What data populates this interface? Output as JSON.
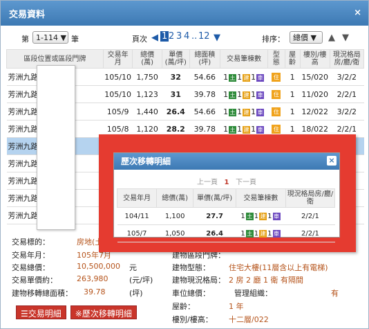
{
  "window": {
    "title": "交易資料",
    "close": "×"
  },
  "pager": {
    "prefix": "第",
    "range": "1-114",
    "suffix": "筆",
    "page_label": "頁次",
    "pages": [
      "1",
      "2",
      "3",
      "4",
      "..",
      " 12"
    ],
    "sort_label": "排序：",
    "sort_value": "總價"
  },
  "columns": [
    "區段位置或區段門牌",
    "交易年月",
    "總價(萬)",
    "單價(萬/坪)",
    "總面積(坪)",
    "交易筆棟數",
    "型態",
    "屋齡",
    "樓別/樓高",
    "現況格局房/廳/衛"
  ],
  "rows": [
    {
      "addr": "芳洲九路",
      "date": "105/10",
      "total": "1,750",
      "unit": "32",
      "area": "54.66",
      "counts": [
        "1",
        "1",
        "1"
      ],
      "type": "住",
      "age": "1",
      "floor": "15/020",
      "layout": "3/2/2"
    },
    {
      "addr": "芳洲九路",
      "date": "105/10",
      "total": "1,123",
      "unit": "31",
      "area": "39.78",
      "counts": [
        "1",
        "1",
        "1"
      ],
      "type": "住",
      "age": "1",
      "floor": "11/020",
      "layout": "2/2/1"
    },
    {
      "addr": "芳洲九路",
      "date": "105/9",
      "total": "1,440",
      "unit": "26.4",
      "area": "54.66",
      "counts": [
        "1",
        "1",
        "1"
      ],
      "type": "住",
      "age": "1",
      "floor": "12/022",
      "layout": "3/2/2"
    },
    {
      "addr": "芳洲九路",
      "date": "105/8",
      "total": "1,120",
      "unit": "28.2",
      "area": "39.78",
      "counts": [
        "1",
        "1",
        "1"
      ],
      "type": "住",
      "age": "1",
      "floor": "18/022",
      "layout": "2/2/1"
    },
    {
      "addr": "芳洲九路",
      "date": "",
      "total": "",
      "unit": "",
      "area": "",
      "counts": [
        "",
        "",
        ""
      ],
      "type": "",
      "age": "",
      "floor": "",
      "layout": ""
    },
    {
      "addr": "芳洲九路",
      "date": "",
      "total": "",
      "unit": "",
      "area": "",
      "counts": [
        "",
        "",
        ""
      ],
      "type": "",
      "age": "",
      "floor": "",
      "layout": ""
    },
    {
      "addr": "芳洲九路",
      "date": "",
      "total": "",
      "unit": "",
      "area": "",
      "counts": [
        "",
        "",
        ""
      ],
      "type": "",
      "age": "",
      "floor": "",
      "layout": ""
    },
    {
      "addr": "芳洲九路",
      "date": "",
      "total": "",
      "unit": "",
      "area": "",
      "counts": [
        "",
        "",
        ""
      ],
      "type": "",
      "age": "",
      "floor": "",
      "layout": ""
    },
    {
      "addr": "芳洲九路",
      "date": "",
      "total": "",
      "unit": "",
      "area": "",
      "counts": [
        "",
        "",
        ""
      ],
      "type": "",
      "age": "",
      "floor": "",
      "layout": ""
    }
  ],
  "detail": {
    "target_label": "交易標的：",
    "target_value": "房地(土",
    "date_label": "交易年月：",
    "date_value": "105年7月",
    "total_label": "交易總價：",
    "total_value": "10,500,000",
    "total_unit": "元",
    "unit_label": "交易單價約：",
    "unit_value": "263,980",
    "unit_unit": "(元/坪)",
    "area_label": "建物移轉總面積：",
    "area_value": "39.78",
    "area_unit": "(坪)",
    "btype_label": "建物型態：",
    "btype_value": "住宅大樓(11層含以上有電梯)",
    "blayout_label": "建物現況格局：",
    "blayout_value": "2 房 2 廳 1 衛 有隔間",
    "park_label": "車位總價：",
    "org_label": "管理組織：",
    "org_value": "有",
    "age_label": "屋齡：",
    "age_value": "1 年",
    "floor_label": "樓別/樓高：",
    "floor_value": "十二層/022",
    "extra_label": "建物區段門牌："
  },
  "buttons": {
    "detail": "☰交易明細",
    "history": "※歷次移轉明細"
  },
  "popup": {
    "title": "歷次移轉明細",
    "close": "×",
    "prev": "上一頁",
    "page": "1",
    "next": "下一頁",
    "columns": [
      "交易年月",
      "總價(萬)",
      "單價(萬/坪)",
      "交易筆棟數",
      "現況格局房/廳/衛"
    ],
    "rows": [
      {
        "date": "104/11",
        "total": "1,100",
        "unit": "27.7",
        "counts": [
          "1",
          "1",
          "1"
        ],
        "layout": "2/2/1"
      },
      {
        "date": "105/7",
        "total": "1,050",
        "unit": "26.4",
        "counts": [
          "1",
          "1",
          "1"
        ],
        "layout": "2/2/1"
      }
    ]
  },
  "legend": {
    "land": "土",
    "build": "建",
    "car": "車"
  },
  "colors": {
    "title_bg": "#3d79b3",
    "overlay": "#e53b30",
    "highlight": "#b5d3ef"
  }
}
